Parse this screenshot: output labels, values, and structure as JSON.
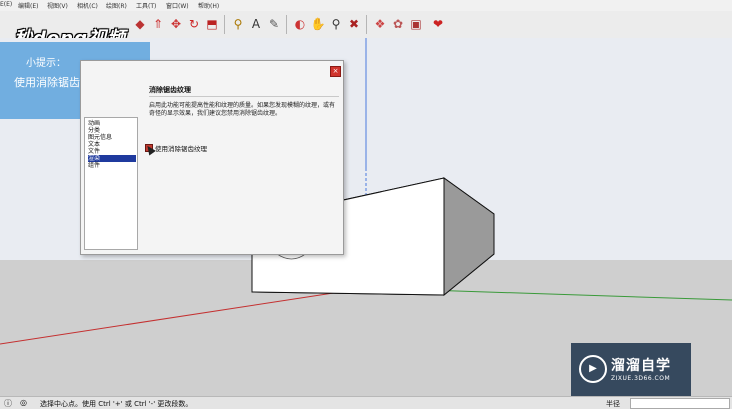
{
  "menu": [
    "E(E)",
    "编辑(E)",
    "视图(V)",
    "相机(C)",
    "绘图(R)",
    "工具(T)",
    "窗口(W)",
    "帮助(H)"
  ],
  "logo_text": "秒dong视频",
  "toolbar_icons": [
    "paint-bucket-icon",
    "pushpull-icon",
    "move-icon",
    "rotate-icon",
    "scale-icon",
    "tape-measure-icon",
    "text-tool-icon",
    "paint-icon",
    "orbit-icon",
    "pan-icon",
    "zoom-icon",
    "zoom-extents-icon",
    "components-icon",
    "styles-icon",
    "ruby-icon"
  ],
  "tip": {
    "title": "小提示：",
    "body": "使用消除锯齿纹理"
  },
  "dialog": {
    "heading": "消除锯齿纹理",
    "description": "启用此功能可能提高性能和纹理的质量。如果您发现模糊的纹理，或有奇怪的显示效果，我们建议您禁用消除锯齿纹理。",
    "categories": [
      "动画",
      "分类",
      "图元信息",
      "文本",
      "文件",
      "渲染",
      "组件"
    ],
    "selected_category": "渲染",
    "option_label": "使用消除锯齿纹理",
    "option_checked": true,
    "close_label": "×"
  },
  "watermark": {
    "name": "溜溜自学",
    "site": "ZIXUE.3D66.COM"
  },
  "status": {
    "text": "选择中心点。使用 Ctrl '+' 或 Ctrl '-' 更改段数。",
    "vcb_label": "半径"
  }
}
